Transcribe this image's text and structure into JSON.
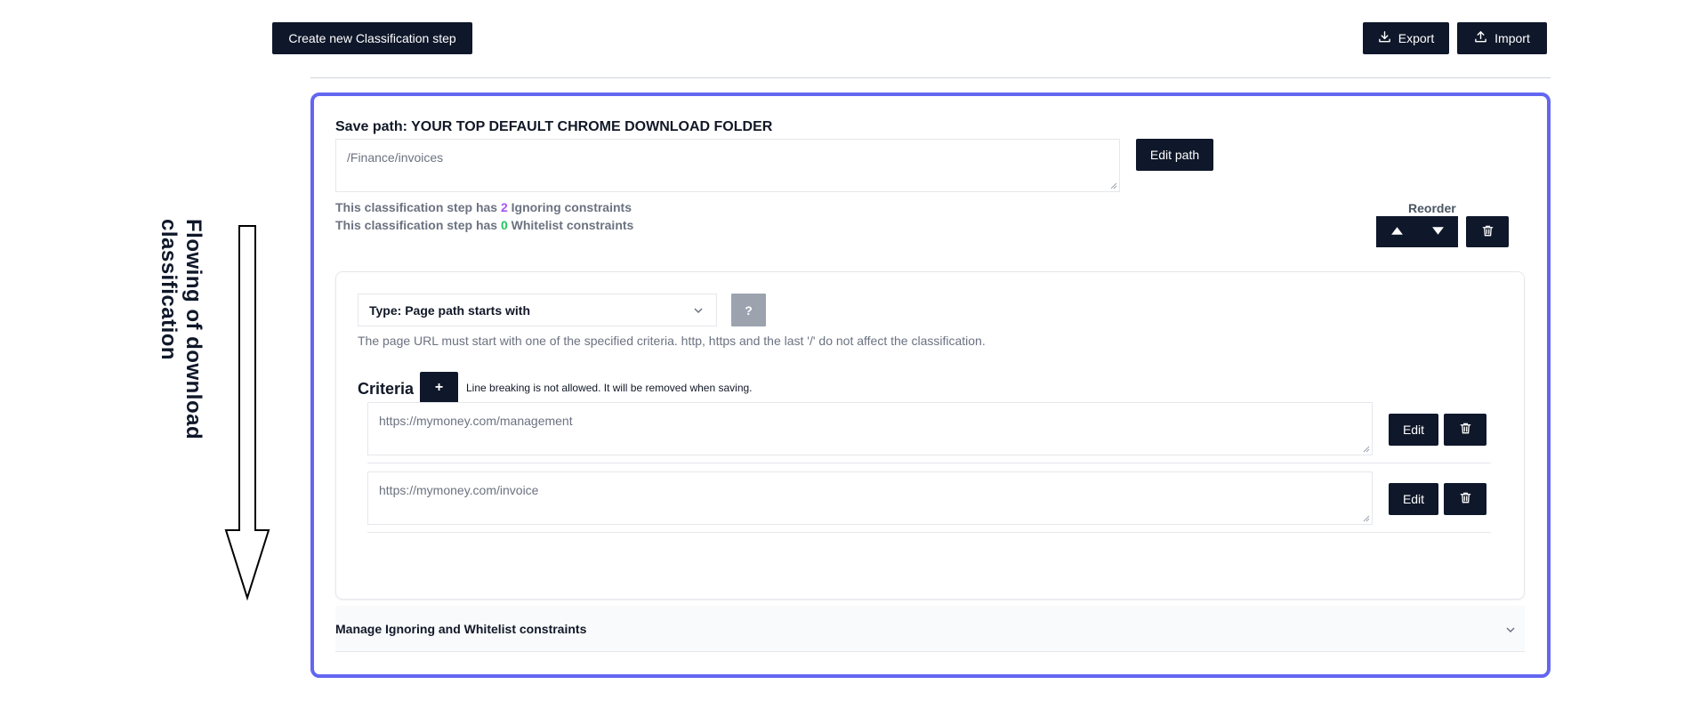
{
  "toolbar": {
    "create_label": "Create new Classification step",
    "export_label": "Export",
    "import_label": "Import"
  },
  "step": {
    "save_path_title": "Save path: YOUR TOP DEFAULT CHROME DOWNLOAD FOLDER",
    "path_value": "/Finance/invoices",
    "edit_path_label": "Edit path",
    "ignoring_prefix": "This classification step has ",
    "ignoring_count": "2",
    "ignoring_suffix": " Ignoring constraints",
    "whitelist_prefix": "This classification step has ",
    "whitelist_count": "0",
    "whitelist_suffix": " Whitelist constraints",
    "reorder_label": "Reorder",
    "condition": {
      "type_selected": "Type: Page path starts with",
      "help_label": "?",
      "description": "The page URL must start with one of the specified criteria. http, https and the last '/' do not affect the classification.",
      "criteria_title": "Criteria",
      "add_label": "+",
      "hint": "Line breaking is not allowed. It will be removed when saving.",
      "criteria": [
        {
          "value": "https://mymoney.com/management",
          "edit_label": "Edit"
        },
        {
          "value": "https://mymoney.com/invoice",
          "edit_label": "Edit"
        }
      ]
    },
    "accordion_label": "Manage Ignoring and Whitelist constraints"
  },
  "annotation": {
    "flow_label": "Flowing of download classification"
  },
  "colors": {
    "dark_button": "#0f172a",
    "card_border": "#6366f1",
    "ignoring_count": "#a855f7",
    "whitelist_count": "#22c55e",
    "help_button": "#9ca3af"
  },
  "icons": [
    "download-icon",
    "upload-icon",
    "triangle-up-icon",
    "triangle-down-icon",
    "trash-icon",
    "chevron-down-icon",
    "down-arrow-icon"
  ]
}
